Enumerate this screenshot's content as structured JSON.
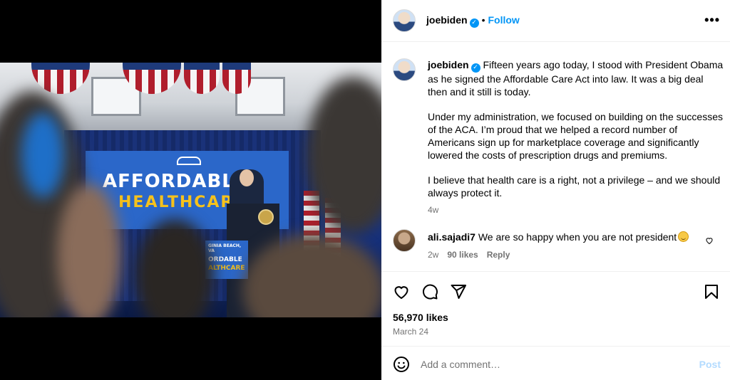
{
  "media": {
    "banner_line1": "AFFORDABLE",
    "banner_line2": "HEALTHCARE",
    "sign_line0": "GINIA BEACH, VA",
    "sign_line1": "ORDABLE",
    "sign_line2": "ALTHCARE"
  },
  "header": {
    "username": "joebiden",
    "verified": "✓",
    "separator": "•",
    "follow_label": "Follow",
    "more_icon": "•••"
  },
  "caption": {
    "username": "joebiden",
    "verified": "✓",
    "p1": "Fifteen years ago today, I stood with President Obama as he signed the Affordable Care Act into law. It was a big deal then and it still is today.",
    "p2": "Under my administration, we focused on building on the successes of the ACA. I’m proud that we helped a record number of Americans sign up for marketplace coverage and significantly lowered the costs of prescription drugs and premiums.",
    "p3": "I believe that health care is a right, not a privilege – and we should always protect it.",
    "time": "4w"
  },
  "comment": {
    "username": "ali.sajadi7",
    "text": "We are so happy when you are not president",
    "time": "2w",
    "likes": "90 likes",
    "reply": "Reply"
  },
  "stats": {
    "likes": "56,970 likes",
    "date": "March 24"
  },
  "add_comment": {
    "placeholder": "Add a comment…",
    "post": "Post"
  },
  "icons": {
    "like": "heart-icon",
    "comment": "comment-bubble-icon",
    "share": "paper-plane-icon",
    "save": "bookmark-icon",
    "emoji": "smiley-icon"
  },
  "colors": {
    "accent": "#0095f6",
    "muted": "#737373",
    "post_disabled": "#b3dbff"
  }
}
